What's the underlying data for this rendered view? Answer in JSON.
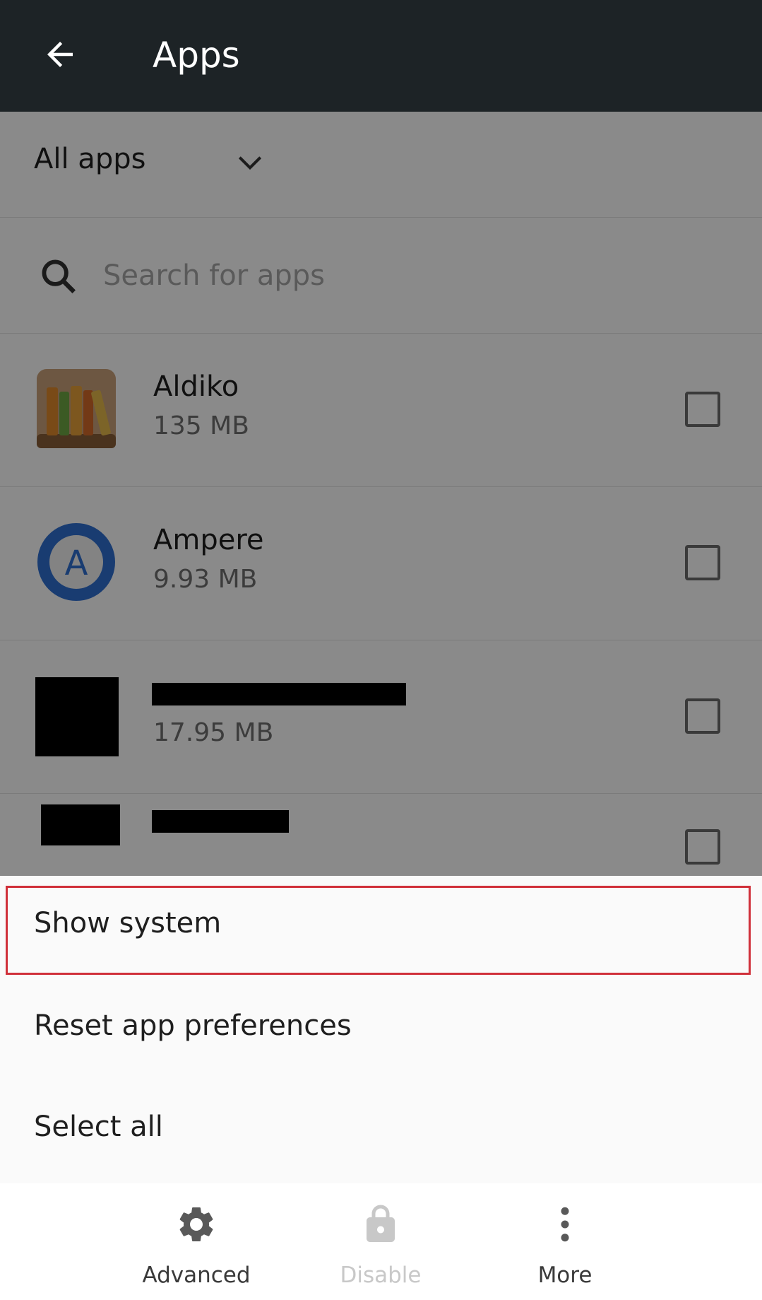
{
  "appbar": {
    "title": "Apps"
  },
  "filter": {
    "label": "All apps"
  },
  "search": {
    "placeholder": "Search for apps"
  },
  "apps": [
    {
      "name": "Aldiko",
      "size": "135 MB"
    },
    {
      "name": "Ampere",
      "size": "9.93 MB"
    },
    {
      "name": "",
      "size": "17.95 MB"
    },
    {
      "name": "",
      "size": ""
    }
  ],
  "menu": {
    "items": [
      {
        "label": "Show system"
      },
      {
        "label": "Reset app preferences"
      },
      {
        "label": "Select all"
      }
    ]
  },
  "bottom_bar": {
    "actions": [
      {
        "label": "Advanced",
        "icon": "gear-icon"
      },
      {
        "label": "Disable",
        "icon": "lock-icon"
      },
      {
        "label": "More",
        "icon": "more-vert-icon"
      }
    ]
  },
  "colors": {
    "appbar": "#1d2326",
    "highlight": "#d0303a",
    "ampere_blue": "#2f6fd1"
  }
}
